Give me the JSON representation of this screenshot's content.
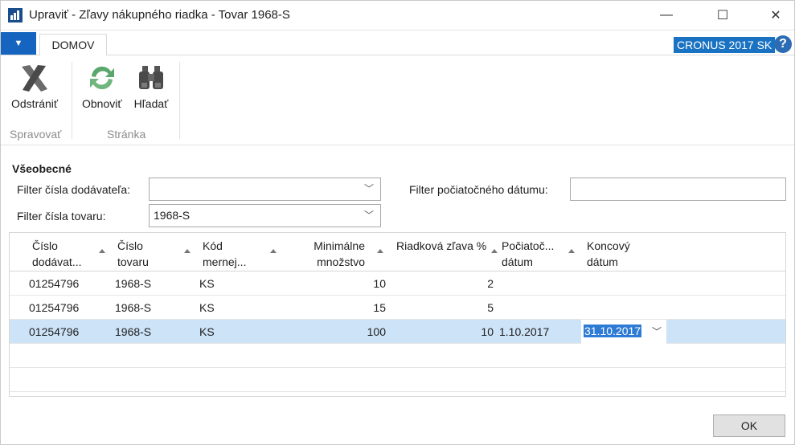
{
  "window": {
    "title": "Upraviť - Zľavy nákupného riadka - Tovar 1968-S",
    "minimize_glyph": "—",
    "maximize_glyph": "☐",
    "close_glyph": "✕"
  },
  "ribbon": {
    "app_menu_glyph": "▼",
    "tab_label": "DOMOV",
    "company": "CRONUS 2017 SK",
    "help_glyph": "?",
    "buttons": {
      "delete": "Odstrániť",
      "refresh": "Obnoviť",
      "find": "Hľadať"
    },
    "groups": {
      "manage": "Spravovať",
      "page": "Stránka"
    }
  },
  "general": {
    "title": "Všeobecné",
    "vendor_filter_label": "Filter čísla dodávateľa:",
    "vendor_filter_value": "",
    "item_filter_label": "Filter čísla tovaru:",
    "item_filter_value": "1968-S",
    "start_date_filter_label": "Filter počiatočného dátumu:",
    "start_date_filter_value": "",
    "chevron": "﹀"
  },
  "grid": {
    "columns": {
      "vendor_no_1": "Číslo",
      "vendor_no_2": "dodávat...",
      "item_no_1": "Číslo",
      "item_no_2": "tovaru",
      "uom_1": "Kód",
      "uom_2": "mernej...",
      "min_qty_1": "Minimálne",
      "min_qty_2": "množstvo",
      "discount": "Riadková zľava %",
      "start_1": "Počiatoč...",
      "start_2": "dátum",
      "end_1": "Koncový",
      "end_2": "dátum"
    },
    "rows": [
      {
        "vendor": "01254796",
        "item": "1968-S",
        "uom": "KS",
        "min_qty": "10",
        "discount": "2",
        "start": "",
        "end": ""
      },
      {
        "vendor": "01254796",
        "item": "1968-S",
        "uom": "KS",
        "min_qty": "15",
        "discount": "5",
        "start": "",
        "end": ""
      },
      {
        "vendor": "01254796",
        "item": "1968-S",
        "uom": "KS",
        "min_qty": "100",
        "discount": "10",
        "start": "1.10.2017",
        "end": "31.10.2017"
      }
    ]
  },
  "footer": {
    "ok_label": "OK"
  },
  "colors": {
    "accent": "#1565c0",
    "selected_row": "#cde3f7",
    "text_selection": "#2e7bd6"
  }
}
